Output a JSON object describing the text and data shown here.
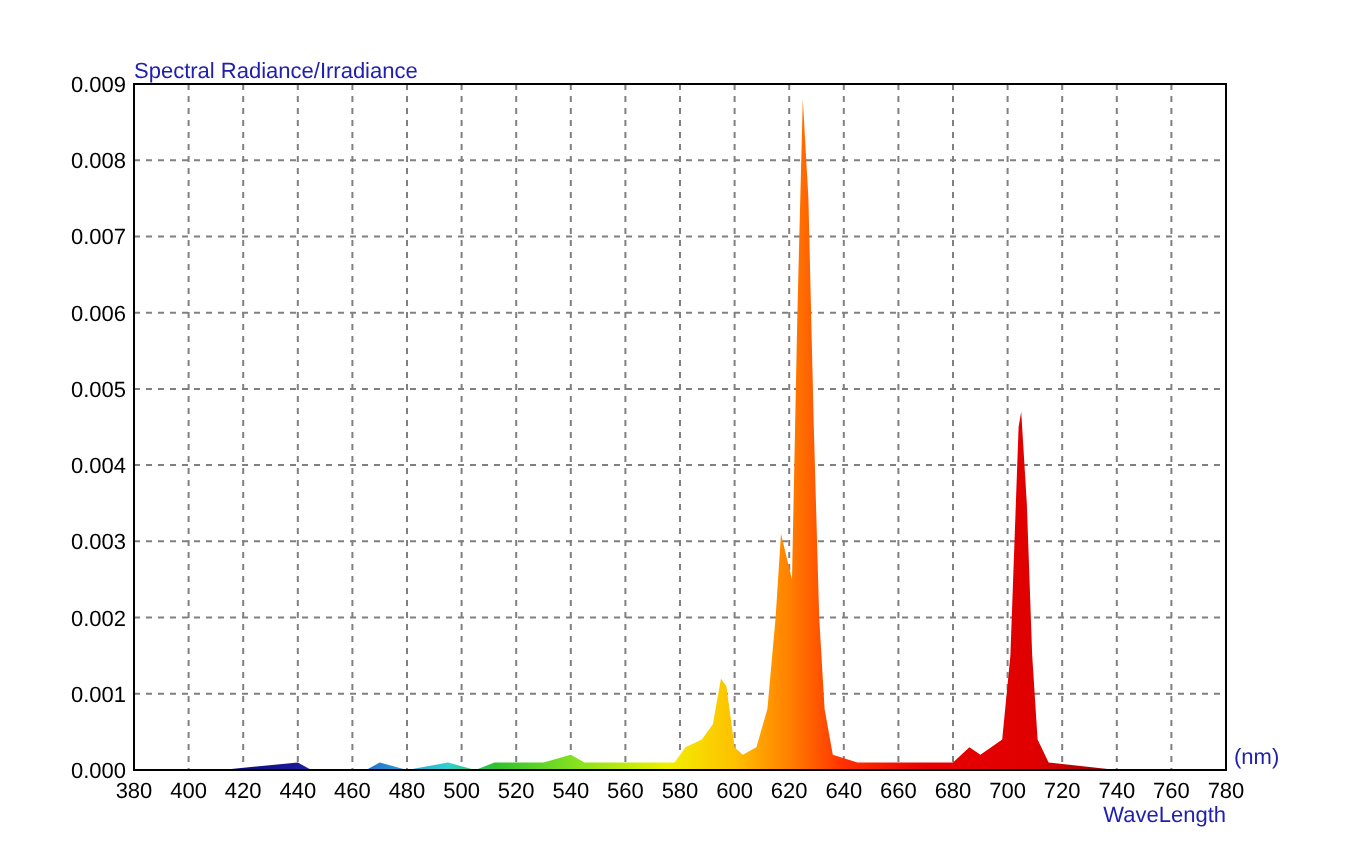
{
  "chart_data": {
    "type": "area",
    "ylabel": "Spectral Radiance/Irradiance",
    "xlabel": "WaveLength",
    "grid": true,
    "x": [
      380,
      410,
      412,
      440,
      445,
      465,
      470,
      480,
      495,
      505,
      512,
      520,
      530,
      540,
      545,
      555,
      570,
      578,
      582,
      588,
      592,
      595,
      597,
      600,
      603,
      608,
      612,
      615,
      617,
      619,
      621,
      623,
      625,
      627,
      629,
      631,
      633,
      636,
      645,
      660,
      680,
      686,
      690,
      694,
      698,
      701,
      704,
      705,
      707,
      709,
      711,
      715,
      740,
      770,
      778
    ],
    "series": [
      {
        "values": [
          0,
          0,
          0,
          0.0001,
          0,
          0,
          0.0001,
          0,
          0.0001,
          0,
          0.0001,
          0.0001,
          0.0001,
          0.0002,
          0.0001,
          0.0001,
          0.0001,
          0.0001,
          0.0003,
          0.0004,
          0.0006,
          0.0012,
          0.0011,
          0.0003,
          0.0002,
          0.0003,
          0.0008,
          0.002,
          0.0031,
          0.0028,
          0.0025,
          0.006,
          0.0088,
          0.0075,
          0.0045,
          0.002,
          0.0008,
          0.0002,
          0.0001,
          0.0001,
          0.0001,
          0.0003,
          0.0002,
          0.0003,
          0.0004,
          0.0015,
          0.0045,
          0.0047,
          0.0035,
          0.0015,
          0.0004,
          0.0001,
          0,
          0,
          0
        ]
      }
    ],
    "xlim": [
      380,
      780
    ],
    "ylim": [
      0,
      0.009
    ],
    "xticks": [
      380,
      400,
      420,
      440,
      460,
      480,
      500,
      520,
      540,
      560,
      580,
      600,
      620,
      640,
      660,
      680,
      700,
      720,
      740,
      760,
      780
    ],
    "yticks": [
      {
        "value": 0,
        "label": "0.000"
      },
      {
        "value": 0.001,
        "label": "0.001"
      },
      {
        "value": 0.002,
        "label": "0.002"
      },
      {
        "value": 0.003,
        "label": "0.003"
      },
      {
        "value": 0.004,
        "label": "0.004"
      },
      {
        "value": 0.005,
        "label": "0.005"
      },
      {
        "value": 0.006,
        "label": "0.006"
      },
      {
        "value": 0.007,
        "label": "0.007"
      },
      {
        "value": 0.008,
        "label": "0.008"
      },
      {
        "value": 0.009,
        "label": "0.009"
      }
    ]
  },
  "unit_label": "(nm)"
}
